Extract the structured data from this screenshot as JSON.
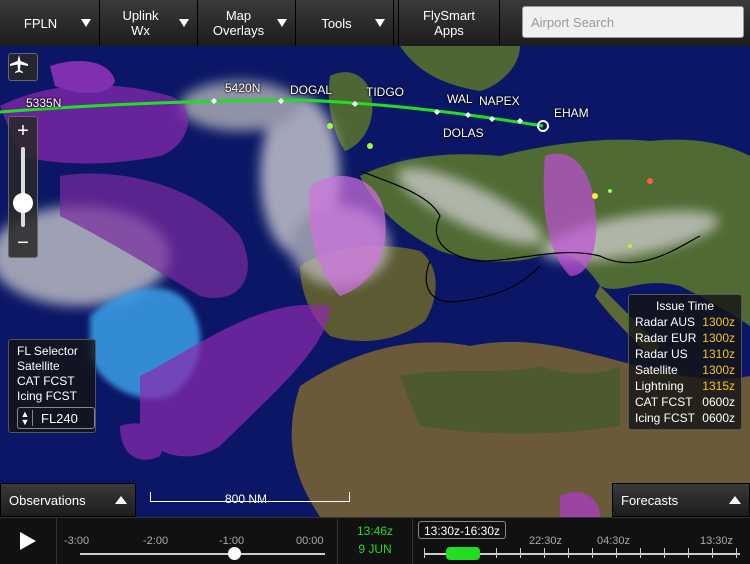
{
  "toolbar": {
    "fpln": "FPLN",
    "uplink_line1": "Uplink",
    "uplink_line2": "Wx",
    "map_line1": "Map",
    "map_line2": "Overlays",
    "tools": "Tools",
    "apps_line1": "FlySmart",
    "apps_line2": "Apps"
  },
  "search": {
    "placeholder": "Airport Search"
  },
  "route": {
    "waypoints": [
      "5335N",
      "5420N",
      "DOGAL",
      "TIDGO",
      "WAL",
      "NAPEX",
      "DOLAS",
      "EHAM"
    ],
    "color": "#22dd22"
  },
  "scale": {
    "label": "800 NM"
  },
  "fl_selector": {
    "title": "FL Selector",
    "item1": "Satellite",
    "item2": "CAT FCST",
    "item3": "Icing FCST",
    "level": "FL240"
  },
  "issue_time": {
    "title": "Issue Time",
    "rows": [
      {
        "label": "Radar AUS",
        "value": "1300z",
        "color": "#f5c518"
      },
      {
        "label": "Radar EUR",
        "value": "1300z",
        "color": "#f5c518"
      },
      {
        "label": "Radar US",
        "value": "1310z",
        "color": "#f5c518"
      },
      {
        "label": "Satellite",
        "value": "1300z",
        "color": "#f5c518"
      },
      {
        "label": "Lightning",
        "value": "1315z",
        "color": "#f5c518"
      },
      {
        "label": "CAT FCST",
        "value": "0600z",
        "color": "#ffffff"
      },
      {
        "label": "Icing FCST",
        "value": "0600z",
        "color": "#ffffff"
      }
    ]
  },
  "observations": {
    "label": "Observations"
  },
  "forecasts": {
    "label": "Forecasts"
  },
  "timeline": {
    "obs_ticks": [
      "-3:00",
      "-2:00",
      "-1:00",
      "00:00"
    ],
    "current_time": "13:46z",
    "current_date": "9 JUN",
    "forecast_range": "13:30z-16:30z",
    "fc_ticks": [
      "22:30z",
      "04:30z",
      "13:30z"
    ],
    "accent": "#22dd22"
  }
}
